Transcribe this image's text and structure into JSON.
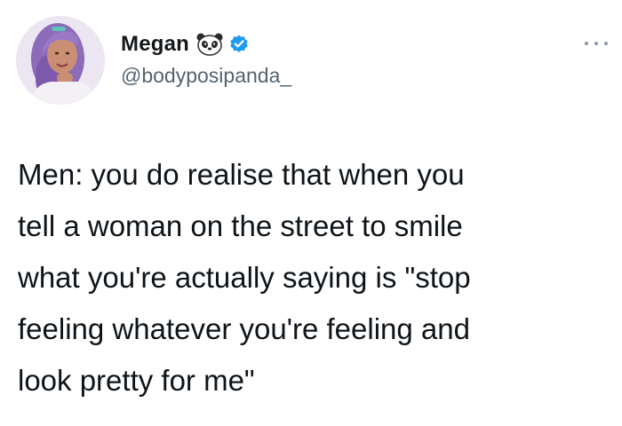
{
  "tweet": {
    "author": {
      "display_name": "Megan",
      "name_emoji": "panda-face-icon",
      "verified": true,
      "handle": "@bodyposipanda_"
    },
    "more_icon": "more-horizontal-icon",
    "text_lines": [
      "Men: you do realise that when you",
      "tell a woman on the street to smile",
      "what you're actually saying is \"stop",
      "feeling whatever you're feeling and",
      "look pretty for me\""
    ]
  },
  "colors": {
    "background": "#ffffff",
    "text_primary": "#0f1419",
    "text_secondary": "#536471",
    "verified_blue": "#1d9bf0",
    "avatar_hair": "#8c6bb8"
  }
}
